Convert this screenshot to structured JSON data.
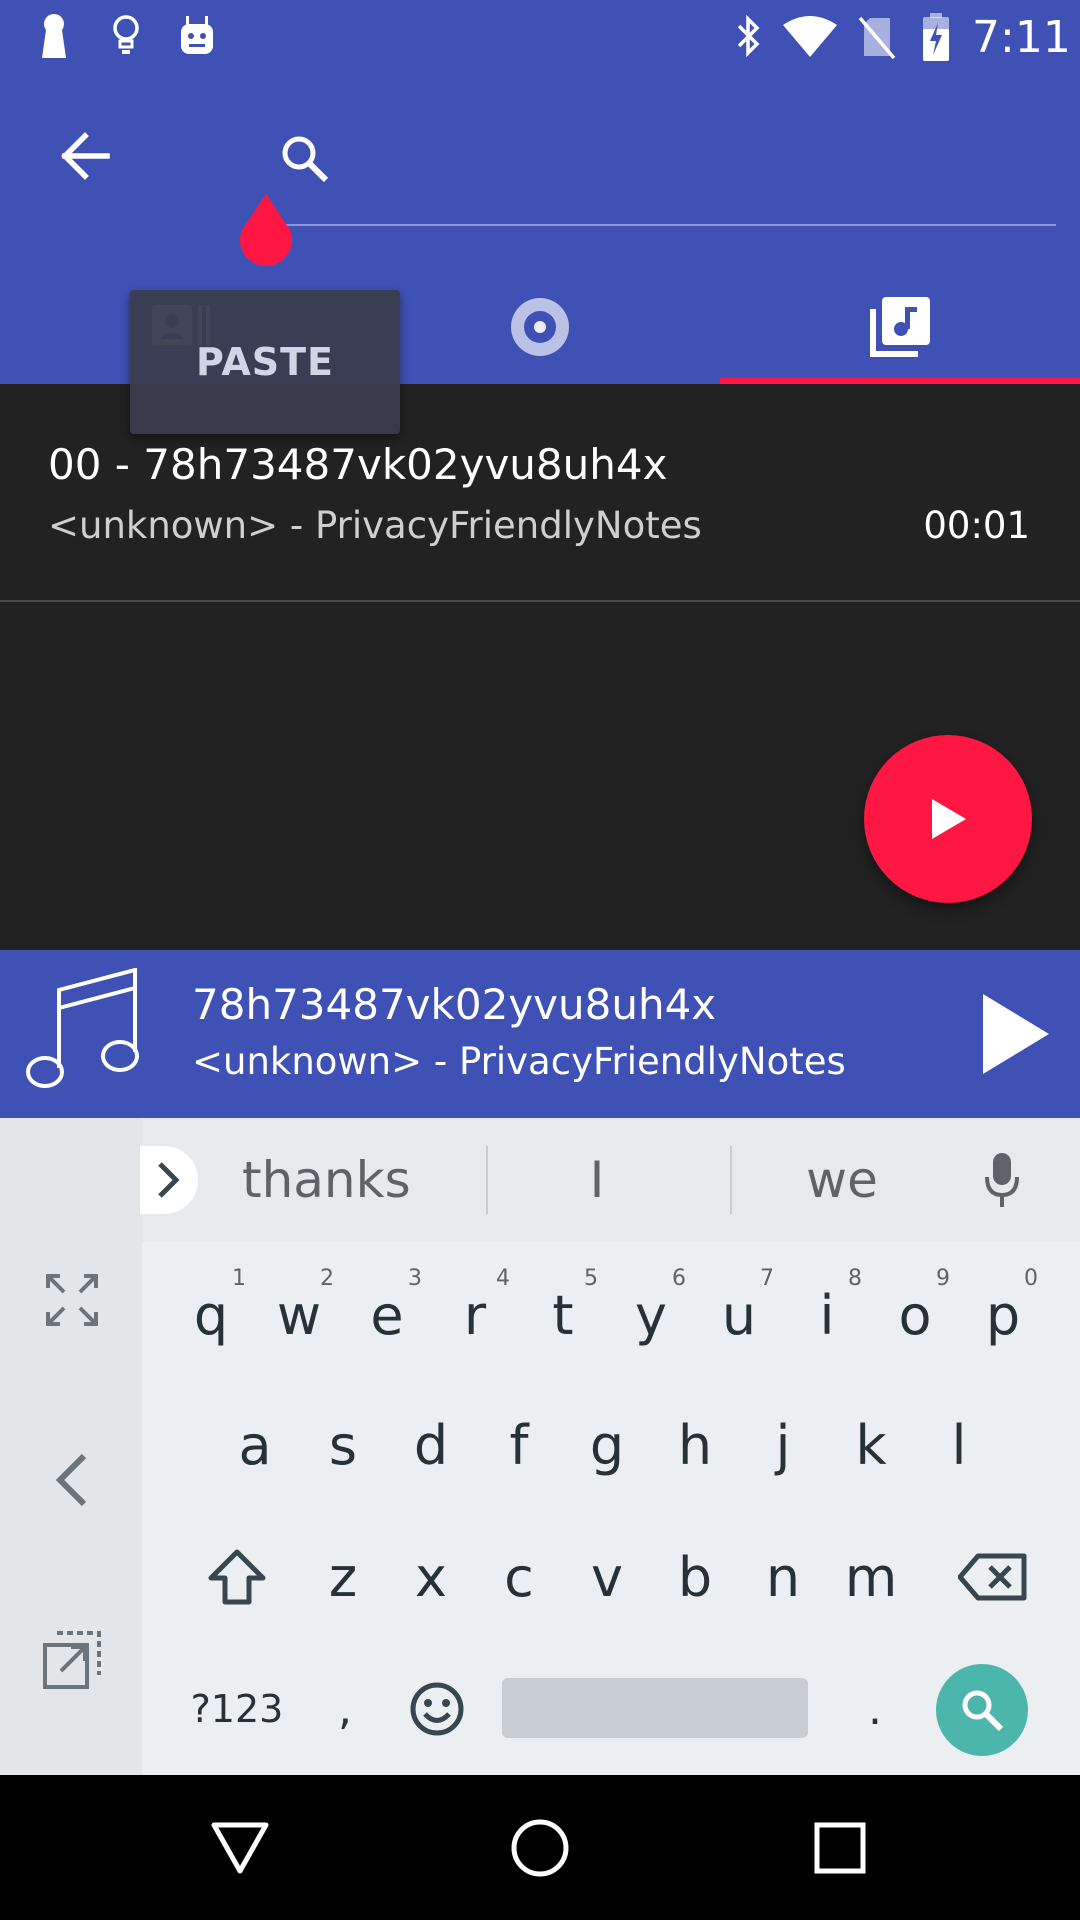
{
  "status_bar": {
    "time": "7:11",
    "left_icons": [
      "keyhole-icon",
      "lightbulb-icon",
      "android-icon"
    ],
    "right_icons": [
      "bluetooth-icon",
      "wifi-icon",
      "no-sim-icon",
      "battery-charging-icon"
    ]
  },
  "toolbar": {
    "back_icon": "arrow-back-icon",
    "search_icon": "search-icon",
    "search_value": ""
  },
  "tabs": {
    "items": [
      {
        "icon": "contact-icon",
        "selected": false
      },
      {
        "icon": "disc-icon",
        "selected": false
      },
      {
        "icon": "music-library-icon",
        "selected": true
      }
    ]
  },
  "paste_popup": {
    "label": "PASTE"
  },
  "list": {
    "items": [
      {
        "title": "00 - 78h73487vk02yvu8uh4x",
        "subtitle": "<unknown> - PrivacyFriendlyNotes",
        "duration": "00:01"
      }
    ]
  },
  "fab": {
    "icon": "play-icon"
  },
  "now_playing": {
    "title": "78h73487vk02yvu8uh4x",
    "subtitle": "<unknown> - PrivacyFriendlyNotes",
    "art_icon": "music-note-icon",
    "play_icon": "play-icon"
  },
  "keyboard": {
    "suggestions": [
      "thanks",
      "I",
      "we"
    ],
    "row1": [
      {
        "k": "q",
        "h": "1"
      },
      {
        "k": "w",
        "h": "2"
      },
      {
        "k": "e",
        "h": "3"
      },
      {
        "k": "r",
        "h": "4"
      },
      {
        "k": "t",
        "h": "5"
      },
      {
        "k": "y",
        "h": "6"
      },
      {
        "k": "u",
        "h": "7"
      },
      {
        "k": "i",
        "h": "8"
      },
      {
        "k": "o",
        "h": "9"
      },
      {
        "k": "p",
        "h": "0"
      }
    ],
    "row2": [
      "a",
      "s",
      "d",
      "f",
      "g",
      "h",
      "j",
      "k",
      "l"
    ],
    "row3": [
      "z",
      "x",
      "c",
      "v",
      "b",
      "n",
      "m"
    ],
    "symbols_label": "?123",
    "comma": ",",
    "period": ".",
    "accent": "#4db6ac"
  },
  "colors": {
    "primary": "#3f51b5",
    "accent": "#ff1744",
    "background": "#222222"
  }
}
